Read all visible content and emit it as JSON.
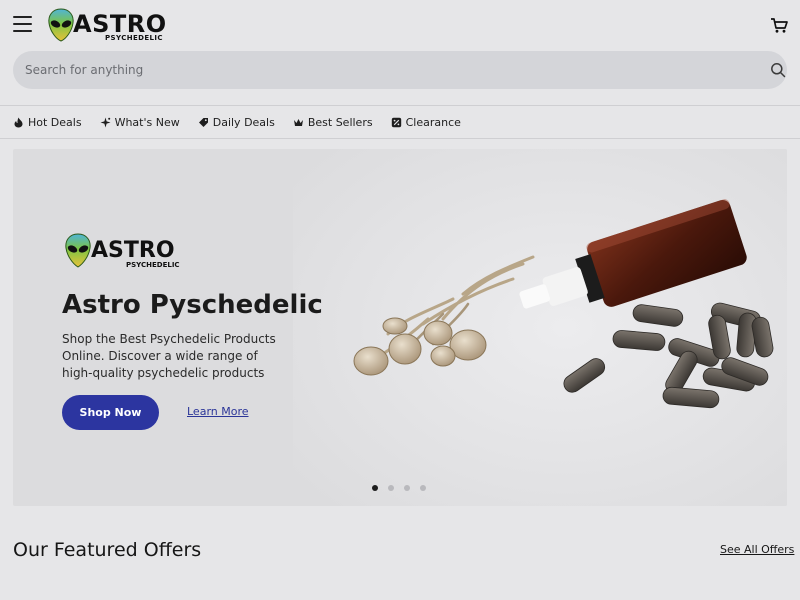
{
  "brand": {
    "name": "ASTRO",
    "tagline": "PSYCHEDELIC"
  },
  "header": {
    "menu_icon": "hamburger-menu-icon",
    "cart_icon": "shopping-cart-icon"
  },
  "search": {
    "placeholder": "Search for anything",
    "icon": "search-icon"
  },
  "nav": {
    "items": [
      {
        "label": "Hot Deals",
        "icon": "flame-icon"
      },
      {
        "label": "What's New",
        "icon": "sparkle-icon"
      },
      {
        "label": "Daily Deals",
        "icon": "tag-icon"
      },
      {
        "label": "Best Sellers",
        "icon": "crown-icon"
      },
      {
        "label": "Clearance",
        "icon": "percent-badge-icon"
      }
    ]
  },
  "hero": {
    "logo_text": "ASTRO",
    "logo_sub": "PSYCHEDELIC",
    "title": "Astro Pyschedelic",
    "description": "Shop the Best Psychedelic Products Online. Discover a wide range of high-quality psychedelic products",
    "primary_button": "Shop Now",
    "secondary_link": "Learn More",
    "slides": 4,
    "active_slide": 1
  },
  "featured": {
    "title": "Our Featured Offers",
    "see_all": "See All Offers"
  },
  "colors": {
    "accent": "#2c35a0",
    "background": "#e6e6e8",
    "search_bg": "#d4d5d9",
    "alien_green": "#6fbf3a"
  }
}
